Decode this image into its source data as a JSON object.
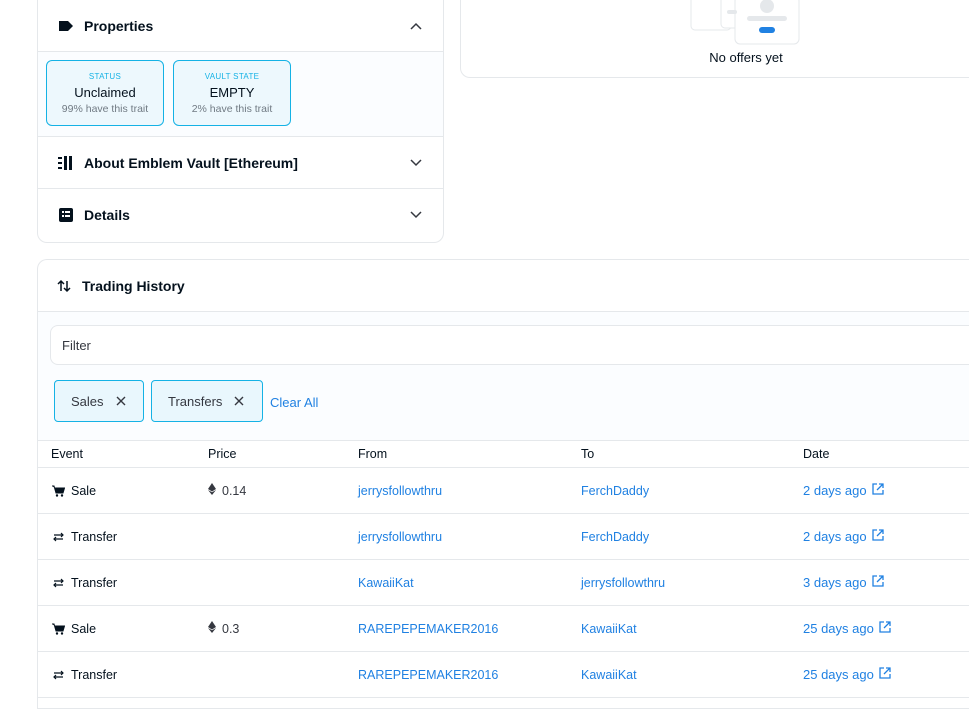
{
  "properties": {
    "title": "Properties",
    "traits": [
      {
        "type": "STATUS",
        "value": "Unclaimed",
        "rarity": "99% have this trait"
      },
      {
        "type": "VAULT STATE",
        "value": "EMPTY",
        "rarity": "2% have this trait"
      }
    ]
  },
  "about": {
    "title": "About Emblem Vault [Ethereum]"
  },
  "details": {
    "title": "Details"
  },
  "offers": {
    "empty_text": "No offers yet"
  },
  "trading_history": {
    "title": "Trading History",
    "filter_placeholder": "Filter",
    "chips": [
      "Sales",
      "Transfers"
    ],
    "clear_all": "Clear All",
    "columns": [
      "Event",
      "Price",
      "From",
      "To",
      "Date"
    ],
    "rows": [
      {
        "event": "Sale",
        "event_icon": "cart-icon",
        "price": "0.14",
        "from": "jerrysfollowthru",
        "to": "FerchDaddy",
        "date": "2 days ago"
      },
      {
        "event": "Transfer",
        "event_icon": "transfer-icon",
        "price": "",
        "from": "jerrysfollowthru",
        "to": "FerchDaddy",
        "date": "2 days ago"
      },
      {
        "event": "Transfer",
        "event_icon": "transfer-icon",
        "price": "",
        "from": "KawaiiKat",
        "to": "jerrysfollowthru",
        "date": "3 days ago"
      },
      {
        "event": "Sale",
        "event_icon": "cart-icon",
        "price": "0.3",
        "from": "RAREPEPEMAKER2016",
        "to": "KawaiiKat",
        "date": "25 days ago"
      },
      {
        "event": "Transfer",
        "event_icon": "transfer-icon",
        "price": "",
        "from": "RAREPEPEMAKER2016",
        "to": "KawaiiKat",
        "date": "25 days ago"
      }
    ]
  },
  "colors": {
    "accent": "#15b2e5",
    "link": "#2081e2",
    "text": "#04111d",
    "border": "#e5e8eb"
  }
}
